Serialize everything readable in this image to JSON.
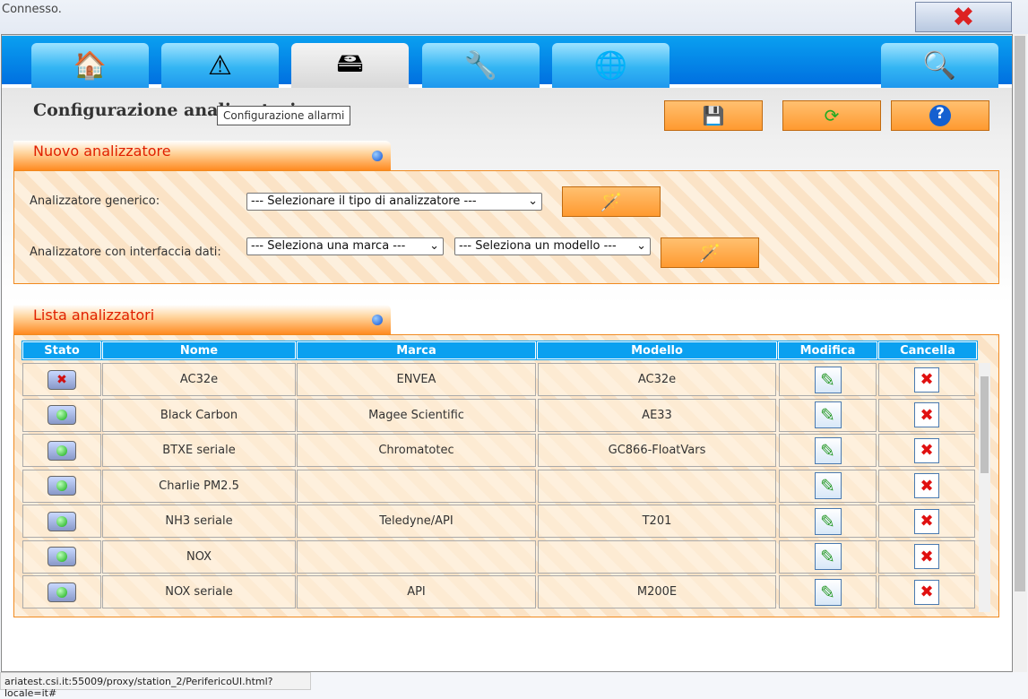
{
  "status_top": "Connesso.",
  "title": "Configurazione analizzatori",
  "tooltip": "Configurazione allarmi",
  "nuovo": {
    "header": "Nuovo analizzatore",
    "generic_label": "Analizzatore generico:",
    "generic_select": "--- Selezionare il tipo di analizzatore ---",
    "data_label": "Analizzatore con interfaccia dati:",
    "brand_select": "--- Seleziona una marca ---",
    "model_select": "--- Seleziona un modello ---"
  },
  "lista": {
    "header": "Lista analizzatori",
    "columns": [
      "Stato",
      "Nome",
      "Marca",
      "Modello",
      "Modifica",
      "Cancella"
    ],
    "rows": [
      {
        "stato": "error",
        "nome": "AC32e",
        "marca": "ENVEA",
        "modello": "AC32e"
      },
      {
        "stato": "ok",
        "nome": "Black Carbon",
        "marca": "Magee Scientific",
        "modello": "AE33"
      },
      {
        "stato": "ok",
        "nome": "BTXE seriale",
        "marca": "Chromatotec",
        "modello": "GC866-FloatVars"
      },
      {
        "stato": "ok",
        "nome": "Charlie PM2.5",
        "marca": "",
        "modello": ""
      },
      {
        "stato": "ok",
        "nome": "NH3 seriale",
        "marca": "Teledyne/API",
        "modello": "T201"
      },
      {
        "stato": "ok",
        "nome": "NOX",
        "marca": "",
        "modello": ""
      },
      {
        "stato": "ok",
        "nome": "NOX seriale",
        "marca": "API",
        "modello": "M200E"
      }
    ]
  },
  "url": "ariatest.csi.it:55009/proxy/station_2/PerifericoUI.html?locale=it#"
}
